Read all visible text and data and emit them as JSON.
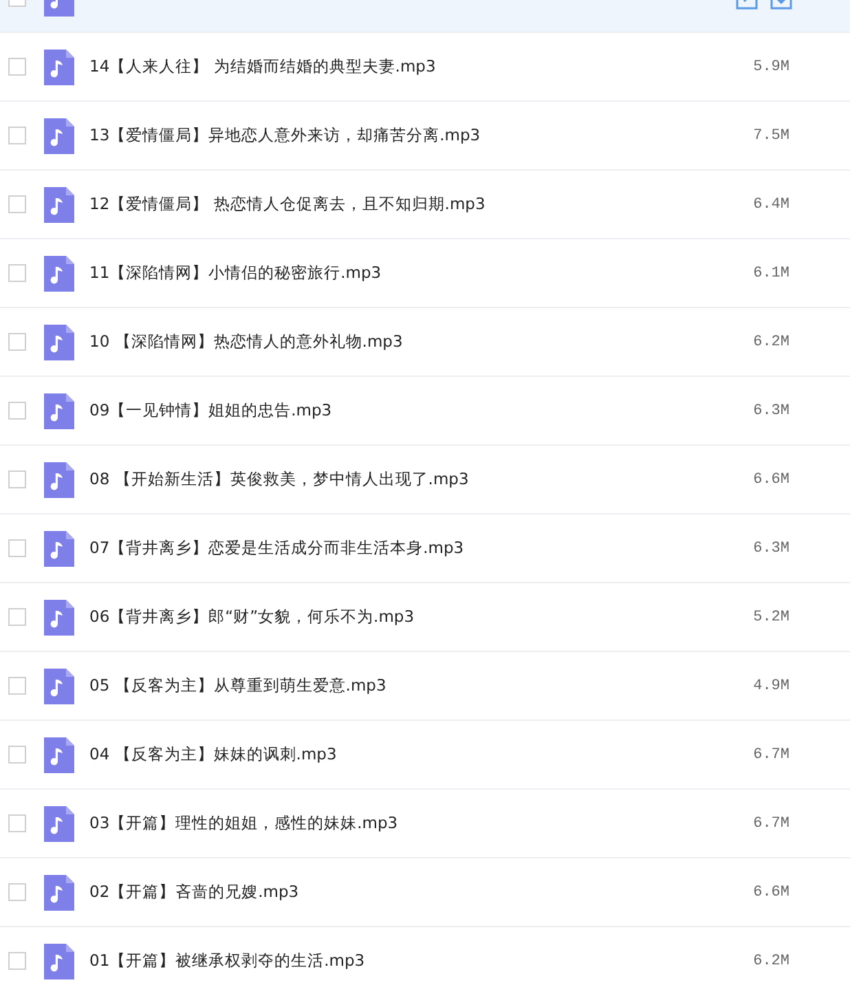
{
  "files": [
    {
      "hovered": true,
      "checked": false
    },
    {
      "name": "14【人来人往】 为结婚而结婚的典型夫妻.mp3",
      "size": "5.9M",
      "hovered": false,
      "checked": false
    },
    {
      "name": "13【爱情僵局】异地恋人意外来访，却痛苦分离.mp3",
      "size": "7.5M",
      "hovered": false,
      "checked": false
    },
    {
      "name": "12【爱情僵局】 热恋情人仓促离去，且不知归期.mp3",
      "size": "6.4M",
      "hovered": false,
      "checked": false
    },
    {
      "name": "11【深陷情网】小情侣的秘密旅行.mp3",
      "size": "6.1M",
      "hovered": false,
      "checked": false
    },
    {
      "name": "10 【深陷情网】热恋情人的意外礼物.mp3",
      "size": "6.2M",
      "hovered": false,
      "checked": false
    },
    {
      "name": "09【一见钟情】姐姐的忠告.mp3",
      "size": "6.3M",
      "hovered": false,
      "checked": false
    },
    {
      "name": "08 【开始新生活】英俊救美，梦中情人出现了.mp3",
      "size": "6.6M",
      "hovered": false,
      "checked": false
    },
    {
      "name": "07【背井离乡】恋爱是生活成分而非生活本身.mp3",
      "size": "6.3M",
      "hovered": false,
      "checked": false
    },
    {
      "name": "06【背井离乡】郎“财”女貌，何乐不为.mp3",
      "size": "5.2M",
      "hovered": false,
      "checked": false
    },
    {
      "name": "05 【反客为主】从尊重到萌生爱意.mp3",
      "size": "4.9M",
      "hovered": false,
      "checked": false
    },
    {
      "name": "04 【反客为主】妹妹的讽刺.mp3",
      "size": "6.7M",
      "hovered": false,
      "checked": false
    },
    {
      "name": "03【开篇】理性的姐姐，感性的妹妹.mp3",
      "size": "6.7M",
      "hovered": false,
      "checked": false
    },
    {
      "name": "02【开篇】吝啬的兄嫂.mp3",
      "size": "6.6M",
      "hovered": false,
      "checked": false
    },
    {
      "name": "01【开篇】被继承权剥夺的生活.mp3",
      "size": "6.2M",
      "hovered": false,
      "checked": false
    }
  ]
}
